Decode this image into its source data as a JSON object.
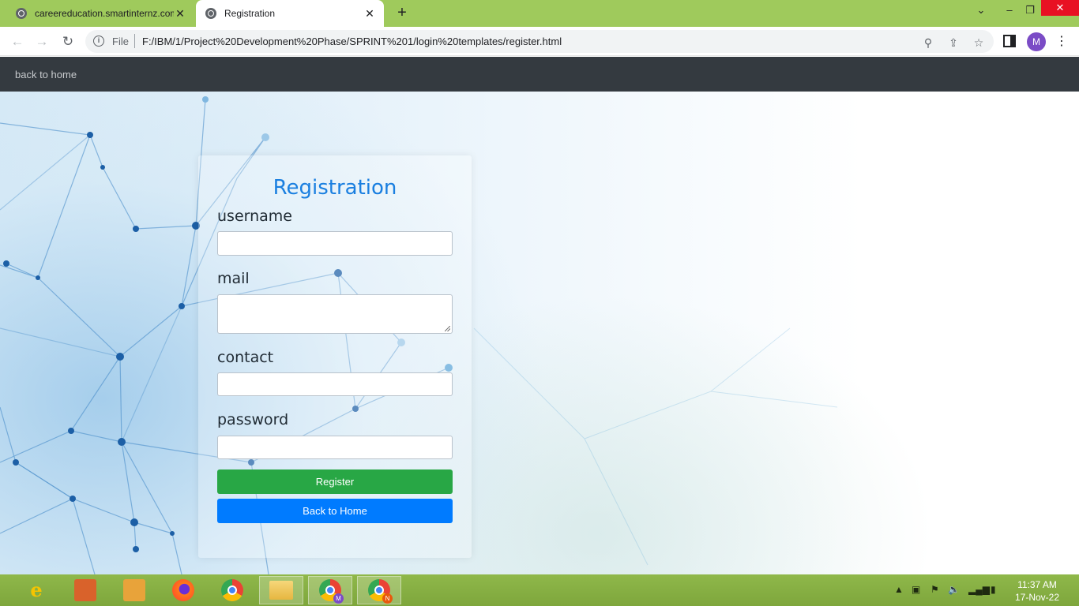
{
  "browser": {
    "tabs": [
      {
        "title": "careereducation.smartinternz.com",
        "active": false
      },
      {
        "title": "Registration",
        "active": true
      }
    ],
    "new_tab_symbol": "+",
    "omnibox": {
      "scheme_label": "File",
      "url": "F:/IBM/1/Project%20Development%20Phase/SPRINT%201/login%20templates/register.html"
    },
    "profile_initial": "M"
  },
  "page": {
    "nav_link": "back to home",
    "form": {
      "title": "Registration",
      "fields": [
        {
          "label": "username",
          "value": ""
        },
        {
          "label": "mail",
          "value": ""
        },
        {
          "label": "contact",
          "value": ""
        },
        {
          "label": "password",
          "value": ""
        }
      ],
      "register_label": "Register",
      "back_label": "Back to Home"
    },
    "colors": {
      "title": "#1a7fe0",
      "register_button": "#28a745",
      "back_button": "#007bff",
      "navbar": "#343a40"
    }
  },
  "taskbar": {
    "apps": [
      "internet-explorer-icon",
      "installer-icon",
      "media-icon",
      "firefox-icon",
      "chrome-icon",
      "file-explorer-icon",
      "chrome-profile-m-icon",
      "chrome-profile-n-icon"
    ],
    "badges": {
      "m": "M",
      "n": "N"
    },
    "clock": {
      "time": "11:37 AM",
      "date": "17-Nov-22"
    }
  }
}
